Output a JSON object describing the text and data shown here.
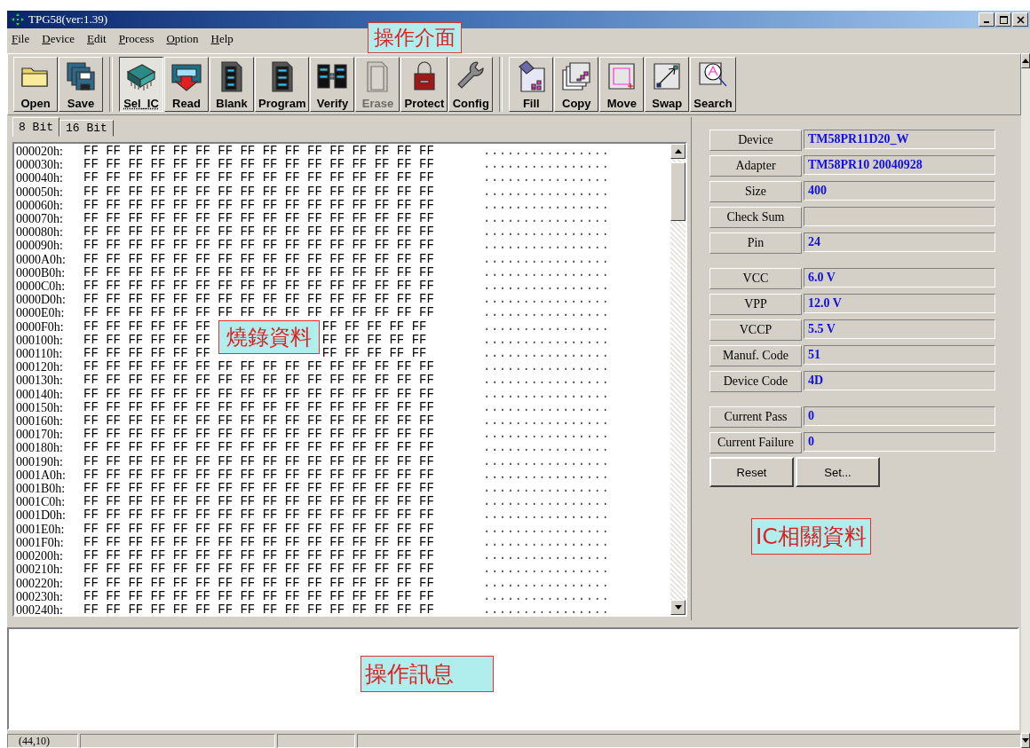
{
  "window": {
    "title": "TPG58(ver:1.39)"
  },
  "menu": [
    "File",
    "Device",
    "Edit",
    "Process",
    "Option",
    "Help"
  ],
  "toolbar": [
    {
      "label": "Open",
      "selected": false,
      "disabled": false
    },
    {
      "label": "Save",
      "selected": false,
      "disabled": false
    },
    {
      "label": "Sel_IC",
      "selected": true,
      "disabled": false
    },
    {
      "label": "Read",
      "selected": false,
      "disabled": false
    },
    {
      "label": "Blank",
      "selected": false,
      "disabled": false
    },
    {
      "label": "Program",
      "selected": false,
      "disabled": false
    },
    {
      "label": "Verify",
      "selected": false,
      "disabled": false
    },
    {
      "label": "Erase",
      "selected": false,
      "disabled": true
    },
    {
      "label": "Protect",
      "selected": false,
      "disabled": false
    },
    {
      "label": "Config",
      "selected": false,
      "disabled": false
    },
    {
      "label": "Fill",
      "selected": false,
      "disabled": false
    },
    {
      "label": "Copy",
      "selected": false,
      "disabled": false
    },
    {
      "label": "Move",
      "selected": false,
      "disabled": false
    },
    {
      "label": "Swap",
      "selected": false,
      "disabled": false
    },
    {
      "label": "Search",
      "selected": false,
      "disabled": false
    }
  ],
  "tabs": [
    {
      "label": "8 Bit",
      "selected": true
    },
    {
      "label": "16 Bit",
      "selected": false
    }
  ],
  "hex_rows": [
    {
      "address": "000020h:",
      "bytes": "FF FF FF FF FF FF FF FF FF FF FF FF FF FF FF FF",
      "ascii": "................"
    },
    {
      "address": "000030h:",
      "bytes": "FF FF FF FF FF FF FF FF FF FF FF FF FF FF FF FF",
      "ascii": "................"
    },
    {
      "address": "000040h:",
      "bytes": "FF FF FF FF FF FF FF FF FF FF FF FF FF FF FF FF",
      "ascii": "................"
    },
    {
      "address": "000050h:",
      "bytes": "FF FF FF FF FF FF FF FF FF FF FF FF FF FF FF FF",
      "ascii": "................"
    },
    {
      "address": "000060h:",
      "bytes": "FF FF FF FF FF FF FF FF FF FF FF FF FF FF FF FF",
      "ascii": "................"
    },
    {
      "address": "000070h:",
      "bytes": "FF FF FF FF FF FF FF FF FF FF FF FF FF FF FF FF",
      "ascii": "................"
    },
    {
      "address": "000080h:",
      "bytes": "FF FF FF FF FF FF FF FF FF FF FF FF FF FF FF FF",
      "ascii": "................"
    },
    {
      "address": "000090h:",
      "bytes": "FF FF FF FF FF FF FF FF FF FF FF FF FF FF FF FF",
      "ascii": "................"
    },
    {
      "address": "0000A0h:",
      "bytes": "FF FF FF FF FF FF FF FF FF FF FF FF FF FF FF FF",
      "ascii": "................"
    },
    {
      "address": "0000B0h:",
      "bytes": "FF FF FF FF FF FF FF FF FF FF FF FF FF FF FF FF",
      "ascii": "................"
    },
    {
      "address": "0000C0h:",
      "bytes": "FF FF FF FF FF FF FF FF FF FF FF FF FF FF FF FF",
      "ascii": "................"
    },
    {
      "address": "0000D0h:",
      "bytes": "FF FF FF FF FF FF FF FF FF FF FF FF FF FF FF FF",
      "ascii": "................"
    },
    {
      "address": "0000E0h:",
      "bytes": "FF FF FF FF FF FF FF FF FF FF FF FF FF FF FF FF",
      "ascii": "................"
    },
    {
      "address": "0000F0h:",
      "bytes": "FF FF FF FF FF FF",
      "bytes_after": "FF FF FF FF FF",
      "ascii": "................"
    },
    {
      "address": "000100h:",
      "bytes": "FF FF FF FF FF FF",
      "bytes_after": "FF FF FF FF FF",
      "ascii": "................"
    },
    {
      "address": "000110h:",
      "bytes": "FF FF FF FF FF FF",
      "bytes_after": "FF FF FF FF FF",
      "ascii": "................"
    },
    {
      "address": "000120h:",
      "bytes": "FF FF FF FF FF FF FF FF FF FF FF FF FF FF FF FF",
      "ascii": "................"
    },
    {
      "address": "000130h:",
      "bytes": "FF FF FF FF FF FF FF FF FF FF FF FF FF FF FF FF",
      "ascii": "................"
    },
    {
      "address": "000140h:",
      "bytes": "FF FF FF FF FF FF FF FF FF FF FF FF FF FF FF FF",
      "ascii": "................"
    },
    {
      "address": "000150h:",
      "bytes": "FF FF FF FF FF FF FF FF FF FF FF FF FF FF FF FF",
      "ascii": "................"
    },
    {
      "address": "000160h:",
      "bytes": "FF FF FF FF FF FF FF FF FF FF FF FF FF FF FF FF",
      "ascii": "................"
    },
    {
      "address": "000170h:",
      "bytes": "FF FF FF FF FF FF FF FF FF FF FF FF FF FF FF FF",
      "ascii": "................"
    },
    {
      "address": "000180h:",
      "bytes": "FF FF FF FF FF FF FF FF FF FF FF FF FF FF FF FF",
      "ascii": "................"
    },
    {
      "address": "000190h:",
      "bytes": "FF FF FF FF FF FF FF FF FF FF FF FF FF FF FF FF",
      "ascii": "................"
    },
    {
      "address": "0001A0h:",
      "bytes": "FF FF FF FF FF FF FF FF FF FF FF FF FF FF FF FF",
      "ascii": "................"
    },
    {
      "address": "0001B0h:",
      "bytes": "FF FF FF FF FF FF FF FF FF FF FF FF FF FF FF FF",
      "ascii": "................"
    },
    {
      "address": "0001C0h:",
      "bytes": "FF FF FF FF FF FF FF FF FF FF FF FF FF FF FF FF",
      "ascii": "................"
    },
    {
      "address": "0001D0h:",
      "bytes": "FF FF FF FF FF FF FF FF FF FF FF FF FF FF FF FF",
      "ascii": "................"
    },
    {
      "address": "0001E0h:",
      "bytes": "FF FF FF FF FF FF FF FF FF FF FF FF FF FF FF FF",
      "ascii": "................"
    },
    {
      "address": "0001F0h:",
      "bytes": "FF FF FF FF FF FF FF FF FF FF FF FF FF FF FF FF",
      "ascii": "................"
    },
    {
      "address": "000200h:",
      "bytes": "FF FF FF FF FF FF FF FF FF FF FF FF FF FF FF FF",
      "ascii": "................"
    },
    {
      "address": "000210h:",
      "bytes": "FF FF FF FF FF FF FF FF FF FF FF FF FF FF FF FF",
      "ascii": "................"
    },
    {
      "address": "000220h:",
      "bytes": "FF FF FF FF FF FF FF FF FF FF FF FF FF FF FF FF",
      "ascii": "................"
    },
    {
      "address": "000230h:",
      "bytes": "FF FF FF FF FF FF FF FF FF FF FF FF FF FF FF FF",
      "ascii": "................"
    },
    {
      "address": "000240h:",
      "bytes": "FF FF FF FF FF FF FF FF FF FF FF FF FF FF FF FF",
      "ascii": "................"
    }
  ],
  "info_groups": [
    [
      {
        "label": "Device",
        "value": "TM58PR11D20_W"
      },
      {
        "label": "Adapter",
        "value": "TM58PR10 20040928"
      },
      {
        "label": "Size",
        "value": "400"
      },
      {
        "label": "Check Sum"
      },
      {
        "label": "Pin",
        "value": "24"
      }
    ],
    [
      {
        "label": "VCC",
        "value": "6.0 V"
      },
      {
        "label": "VPP",
        "value": "12.0 V"
      },
      {
        "label": "VCCP",
        "value": "5.5 V"
      },
      {
        "label": "Manuf. Code",
        "value": "51"
      },
      {
        "label": "Device Code",
        "value": "4D"
      }
    ],
    [
      {
        "label": "Current Pass",
        "value": "0"
      },
      {
        "label": "Current Failure",
        "value": "0"
      }
    ]
  ],
  "buttons": [
    "Reset",
    "Set..."
  ],
  "status_bar": {
    "position": "(44,10)"
  },
  "annotations": [
    {
      "text": "操作介面",
      "kind": "toolbar"
    },
    {
      "text": "燒錄資料",
      "kind": "data"
    },
    {
      "text": "IC相關資料",
      "kind": "info"
    },
    {
      "text": "操作訊息",
      "kind": "message"
    }
  ]
}
